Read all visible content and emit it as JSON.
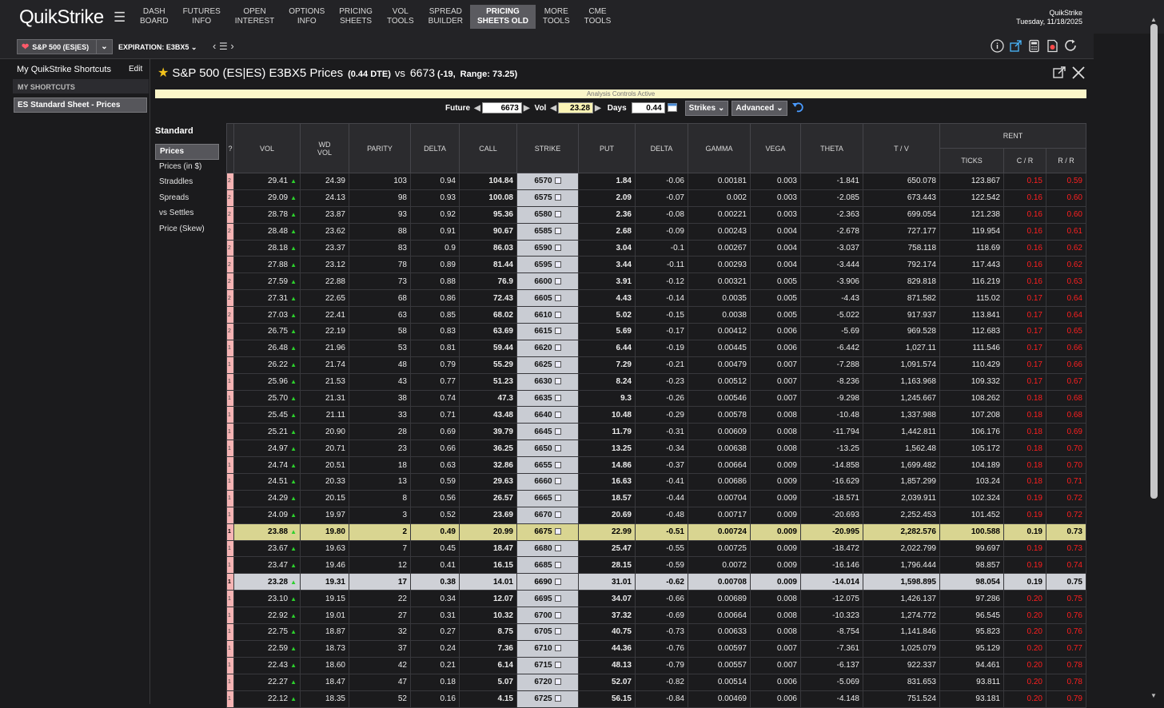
{
  "app": {
    "logo": "QuikStrike",
    "nav": [
      {
        "label": "DASH\nBOARD"
      },
      {
        "label": "FUTURES\nINFO"
      },
      {
        "label": "OPEN\nINTEREST"
      },
      {
        "label": "OPTIONS\nINFO"
      },
      {
        "label": "PRICING\nSHEETS"
      },
      {
        "label": "VOL\nTOOLS"
      },
      {
        "label": "SPREAD\nBUILDER"
      },
      {
        "label": "PRICING\nSHEETS OLD",
        "active": true
      },
      {
        "label": "MORE\nTOOLS"
      },
      {
        "label": "CME\nTOOLS"
      }
    ],
    "brand_right": "QuikStrike",
    "date": "Tuesday, 11/18/2025"
  },
  "toolbar": {
    "product": "S&P 500 (ES|ES)",
    "expiration_label": "EXPIRATION:",
    "expiration_value": "E3BX5"
  },
  "sidebar": {
    "header": "My QuikStrike Shortcuts",
    "edit": "Edit",
    "section": "MY SHORTCUTS",
    "item": "ES Standard Sheet - Prices"
  },
  "header": {
    "title": "S&P 500 (ES|ES) E3BX5 Prices",
    "dte": "(0.44 DTE)",
    "vs": "vs",
    "future": "6673",
    "change": "(-19,",
    "range": "Range: 73.25)"
  },
  "analysis": "Analysis Controls Active",
  "controls": {
    "future_label": "Future",
    "future_value": "6673",
    "vol_label": "Vol",
    "vol_value": "23.28",
    "days_label": "Days",
    "days_value": "0.44",
    "strikes": "Strikes",
    "advanced": "Advanced"
  },
  "tabs": {
    "group": "Standard",
    "items": [
      "Prices",
      "Prices (in $)",
      "Straddles",
      "Spreads",
      "vs Settles",
      "Price (Skew)"
    ]
  },
  "table": {
    "headers": {
      "q": "?",
      "vol": "VOL",
      "wdvol": "WD\nVOL",
      "parity": "PARITY",
      "delta": "DELTA",
      "call": "CALL",
      "strike": "STRIKE",
      "put": "PUT",
      "delta2": "DELTA",
      "gamma": "GAMMA",
      "vega": "VEGA",
      "theta": "THETA",
      "tv": "T / V",
      "rent": "RENT",
      "ticks": "TICKS",
      "cr": "C / R",
      "rr": "R / R"
    },
    "rows": [
      [
        "2",
        "29.41",
        "24.39",
        "103",
        "0.94",
        "104.84",
        "6570",
        "1.84",
        "-0.06",
        "0.00181",
        "0.003",
        "-1.841",
        "650.078",
        "123.867",
        "0.15",
        "0.59"
      ],
      [
        "2",
        "29.09",
        "24.13",
        "98",
        "0.93",
        "100.08",
        "6575",
        "2.09",
        "-0.07",
        "0.002",
        "0.003",
        "-2.085",
        "673.443",
        "122.542",
        "0.16",
        "0.60"
      ],
      [
        "2",
        "28.78",
        "23.87",
        "93",
        "0.92",
        "95.36",
        "6580",
        "2.36",
        "-0.08",
        "0.00221",
        "0.003",
        "-2.363",
        "699.054",
        "121.238",
        "0.16",
        "0.60"
      ],
      [
        "2",
        "28.48",
        "23.62",
        "88",
        "0.91",
        "90.67",
        "6585",
        "2.68",
        "-0.09",
        "0.00243",
        "0.004",
        "-2.678",
        "727.177",
        "119.954",
        "0.16",
        "0.61"
      ],
      [
        "2",
        "28.18",
        "23.37",
        "83",
        "0.9",
        "86.03",
        "6590",
        "3.04",
        "-0.1",
        "0.00267",
        "0.004",
        "-3.037",
        "758.118",
        "118.69",
        "0.16",
        "0.62"
      ],
      [
        "2",
        "27.88",
        "23.12",
        "78",
        "0.89",
        "81.44",
        "6595",
        "3.44",
        "-0.11",
        "0.00293",
        "0.004",
        "-3.444",
        "792.174",
        "117.443",
        "0.16",
        "0.62"
      ],
      [
        "2",
        "27.59",
        "22.88",
        "73",
        "0.88",
        "76.9",
        "6600",
        "3.91",
        "-0.12",
        "0.00321",
        "0.005",
        "-3.906",
        "829.818",
        "116.219",
        "0.16",
        "0.63"
      ],
      [
        "2",
        "27.31",
        "22.65",
        "68",
        "0.86",
        "72.43",
        "6605",
        "4.43",
        "-0.14",
        "0.0035",
        "0.005",
        "-4.43",
        "871.582",
        "115.02",
        "0.17",
        "0.64"
      ],
      [
        "2",
        "27.03",
        "22.41",
        "63",
        "0.85",
        "68.02",
        "6610",
        "5.02",
        "-0.15",
        "0.0038",
        "0.005",
        "-5.022",
        "917.937",
        "113.841",
        "0.17",
        "0.64"
      ],
      [
        "2",
        "26.75",
        "22.19",
        "58",
        "0.83",
        "63.69",
        "6615",
        "5.69",
        "-0.17",
        "0.00412",
        "0.006",
        "-5.69",
        "969.528",
        "112.683",
        "0.17",
        "0.65"
      ],
      [
        "1",
        "26.48",
        "21.96",
        "53",
        "0.81",
        "59.44",
        "6620",
        "6.44",
        "-0.19",
        "0.00445",
        "0.006",
        "-6.442",
        "1,027.11",
        "111.546",
        "0.17",
        "0.66"
      ],
      [
        "1",
        "26.22",
        "21.74",
        "48",
        "0.79",
        "55.29",
        "6625",
        "7.29",
        "-0.21",
        "0.00479",
        "0.007",
        "-7.288",
        "1,091.574",
        "110.429",
        "0.17",
        "0.66"
      ],
      [
        "1",
        "25.96",
        "21.53",
        "43",
        "0.77",
        "51.23",
        "6630",
        "8.24",
        "-0.23",
        "0.00512",
        "0.007",
        "-8.236",
        "1,163.968",
        "109.332",
        "0.17",
        "0.67"
      ],
      [
        "1",
        "25.70",
        "21.31",
        "38",
        "0.74",
        "47.3",
        "6635",
        "9.3",
        "-0.26",
        "0.00546",
        "0.007",
        "-9.298",
        "1,245.667",
        "108.262",
        "0.18",
        "0.68"
      ],
      [
        "1",
        "25.45",
        "21.11",
        "33",
        "0.71",
        "43.48",
        "6640",
        "10.48",
        "-0.29",
        "0.00578",
        "0.008",
        "-10.48",
        "1,337.988",
        "107.208",
        "0.18",
        "0.68"
      ],
      [
        "1",
        "25.21",
        "20.90",
        "28",
        "0.69",
        "39.79",
        "6645",
        "11.79",
        "-0.31",
        "0.00609",
        "0.008",
        "-11.794",
        "1,442.811",
        "106.176",
        "0.18",
        "0.69"
      ],
      [
        "1",
        "24.97",
        "20.71",
        "23",
        "0.66",
        "36.25",
        "6650",
        "13.25",
        "-0.34",
        "0.00638",
        "0.008",
        "-13.25",
        "1,562.48",
        "105.172",
        "0.18",
        "0.70"
      ],
      [
        "1",
        "24.74",
        "20.51",
        "18",
        "0.63",
        "32.86",
        "6655",
        "14.86",
        "-0.37",
        "0.00664",
        "0.009",
        "-14.858",
        "1,699.482",
        "104.189",
        "0.18",
        "0.70"
      ],
      [
        "1",
        "24.51",
        "20.33",
        "13",
        "0.59",
        "29.63",
        "6660",
        "16.63",
        "-0.41",
        "0.00686",
        "0.009",
        "-16.629",
        "1,857.299",
        "103.24",
        "0.18",
        "0.71"
      ],
      [
        "1",
        "24.29",
        "20.15",
        "8",
        "0.56",
        "26.57",
        "6665",
        "18.57",
        "-0.44",
        "0.00704",
        "0.009",
        "-18.571",
        "2,039.911",
        "102.324",
        "0.19",
        "0.72"
      ],
      [
        "1",
        "24.09",
        "19.97",
        "3",
        "0.52",
        "23.69",
        "6670",
        "20.69",
        "-0.48",
        "0.00717",
        "0.009",
        "-20.693",
        "2,252.453",
        "101.452",
        "0.19",
        "0.72"
      ],
      [
        "1",
        "23.88",
        "19.80",
        "2",
        "0.49",
        "20.99",
        "6675",
        "22.99",
        "-0.51",
        "0.00724",
        "0.009",
        "-20.995",
        "2,282.576",
        "100.588",
        "0.19",
        "0.73"
      ],
      [
        "1",
        "23.67",
        "19.63",
        "7",
        "0.45",
        "18.47",
        "6680",
        "25.47",
        "-0.55",
        "0.00725",
        "0.009",
        "-18.472",
        "2,022.799",
        "99.697",
        "0.19",
        "0.73"
      ],
      [
        "1",
        "23.47",
        "19.46",
        "12",
        "0.41",
        "16.15",
        "6685",
        "28.15",
        "-0.59",
        "0.0072",
        "0.009",
        "-16.146",
        "1,796.444",
        "98.857",
        "0.19",
        "0.74"
      ],
      [
        "1",
        "23.28",
        "19.31",
        "17",
        "0.38",
        "14.01",
        "6690",
        "31.01",
        "-0.62",
        "0.00708",
        "0.009",
        "-14.014",
        "1,598.895",
        "98.054",
        "0.19",
        "0.75"
      ],
      [
        "1",
        "23.10",
        "19.15",
        "22",
        "0.34",
        "12.07",
        "6695",
        "34.07",
        "-0.66",
        "0.00689",
        "0.008",
        "-12.075",
        "1,426.137",
        "97.286",
        "0.20",
        "0.75"
      ],
      [
        "1",
        "22.92",
        "19.01",
        "27",
        "0.31",
        "10.32",
        "6700",
        "37.32",
        "-0.69",
        "0.00664",
        "0.008",
        "-10.323",
        "1,274.772",
        "96.545",
        "0.20",
        "0.76"
      ],
      [
        "1",
        "22.75",
        "18.87",
        "32",
        "0.27",
        "8.75",
        "6705",
        "40.75",
        "-0.73",
        "0.00633",
        "0.008",
        "-8.754",
        "1,141.846",
        "95.823",
        "0.20",
        "0.76"
      ],
      [
        "1",
        "22.59",
        "18.73",
        "37",
        "0.24",
        "7.36",
        "6710",
        "44.36",
        "-0.76",
        "0.00597",
        "0.007",
        "-7.361",
        "1,025.079",
        "95.129",
        "0.20",
        "0.77"
      ],
      [
        "1",
        "22.43",
        "18.60",
        "42",
        "0.21",
        "6.14",
        "6715",
        "48.13",
        "-0.79",
        "0.00557",
        "0.007",
        "-6.137",
        "922.337",
        "94.461",
        "0.20",
        "0.78"
      ],
      [
        "1",
        "22.27",
        "18.47",
        "47",
        "0.18",
        "5.07",
        "6720",
        "52.07",
        "-0.82",
        "0.00514",
        "0.006",
        "-5.069",
        "831.653",
        "93.811",
        "0.20",
        "0.78"
      ],
      [
        "1",
        "22.12",
        "18.35",
        "52",
        "0.16",
        "4.15",
        "6725",
        "56.15",
        "-0.84",
        "0.00469",
        "0.006",
        "-4.148",
        "751.524",
        "93.181",
        "0.20",
        "0.79"
      ]
    ],
    "atm_strike": "6675",
    "selected_strike": "6690",
    "colors": {
      "red": "#ff1f1f",
      "atm": "#d9d591",
      "selected": "#cfd1d7",
      "strike": "#c9ccd3"
    }
  }
}
